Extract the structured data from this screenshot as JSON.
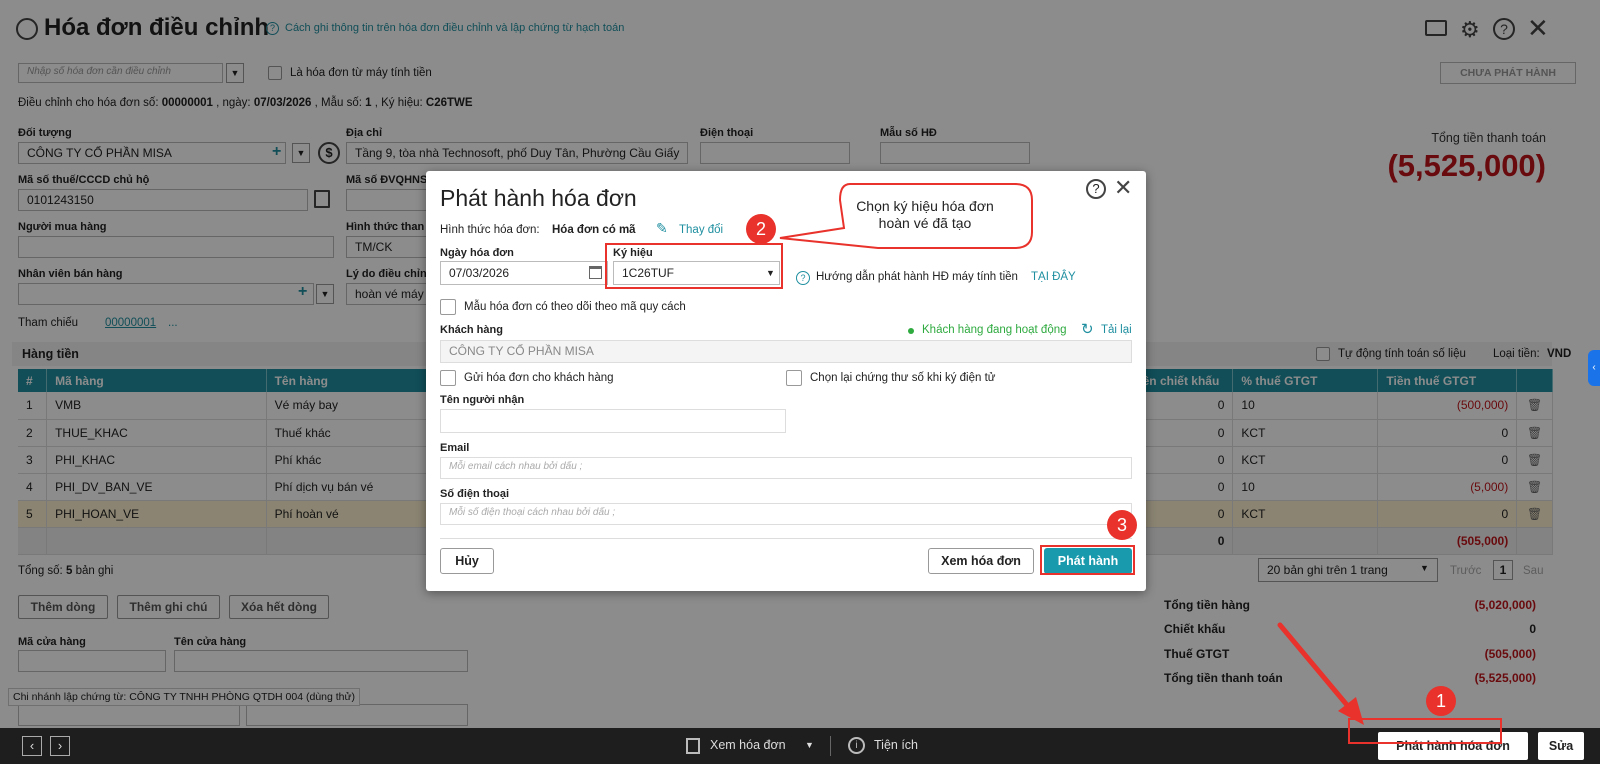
{
  "header": {
    "title": "Hóa đơn điều chỉnh",
    "help_link": "Cách ghi thông tin trên hóa đơn điều chỉnh và lập chứng từ hạch toán"
  },
  "topbar": {
    "search_placeholder": "Nhập số hóa đơn cần điều chỉnh",
    "cash_register_label": "Là hóa đơn từ máy tính tiền",
    "status_button": "CHƯA PHÁT HÀNH",
    "adjust_prefix": "Điều chỉnh cho hóa đơn số:",
    "adjust_number": "00000001",
    "adjust_date_label": ", ngày:",
    "adjust_date": "07/03/2026",
    "adjust_form_label": ", Mẫu số:",
    "adjust_form": "1",
    "adjust_symbol_label": ", Ký hiệu:",
    "adjust_symbol": "C26TWE"
  },
  "form": {
    "doi_tuong_label": "Đối tượng",
    "doi_tuong_value": "CÔNG TY CỔ PHẦN MISA",
    "dia_chi_label": "Địa chỉ",
    "dia_chi_value": "Tầng 9, tòa nhà Technosoft, phố Duy Tân, Phường Cầu Giấy",
    "dien_thoai_label": "Điện thoại",
    "mau_so_hd_label": "Mẫu số HĐ",
    "mst_label": "Mã số thuế/CCCD chủ hộ",
    "mst_value": "0101243150",
    "ma_dvqhns_label": "Mã số ĐVQHNS",
    "nguoi_mua_label": "Người mua hàng",
    "hinh_thuc_label": "Hình thức than",
    "hinh_thuc_value": "TM/CK",
    "nhan_vien_label": "Nhân viên bán hàng",
    "ly_do_label": "Lý do điều chỉnh",
    "ly_do_value": "hoàn vé máy",
    "tham_chieu_label": "Tham chiếu",
    "tham_chieu_value": "00000001",
    "tham_chieu_more": "...",
    "total_label": "Tổng tiền thanh toán",
    "total_value": "(5,525,000)"
  },
  "items": {
    "section_title": "Hàng tiền",
    "auto_calc_label": "Tự động tính toán số liệu",
    "currency_label": "Loại tiền:",
    "currency_value": "VND",
    "columns": [
      "#",
      "Mã hàng",
      "Tên hàng",
      "Tiền chiết khấu",
      "% thuế GTGT",
      "Tiền thuế GTGT"
    ],
    "rows": [
      {
        "no": "1",
        "code": "VMB",
        "name": "Vé máy bay",
        "discount": "0",
        "vat_rate": "10",
        "vat": "(500,000)"
      },
      {
        "no": "2",
        "code": "THUE_KHAC",
        "name": "Thuế khác",
        "discount": "0",
        "vat_rate": "KCT",
        "vat": "0"
      },
      {
        "no": "3",
        "code": "PHI_KHAC",
        "name": "Phí khác",
        "discount": "0",
        "vat_rate": "KCT",
        "vat": "0"
      },
      {
        "no": "4",
        "code": "PHI_DV_BAN_VE",
        "name": "Phí dịch vụ bán vé",
        "discount": "0",
        "vat_rate": "10",
        "vat": "(5,000)"
      },
      {
        "no": "5",
        "code": "PHI_HOAN_VE",
        "name": "Phí hoàn vé",
        "discount": "0",
        "vat_rate": "KCT",
        "vat": "0"
      }
    ],
    "sum_discount": "0",
    "sum_vat": "(505,000)",
    "record_count_label": "Tổng số:",
    "record_count": "5",
    "record_count_suffix": "bản ghi",
    "page_size": "20 bản ghi trên 1 trang",
    "prev": "Trước",
    "page": "1",
    "next": "Sau",
    "add_row": "Thêm dòng",
    "add_note": "Thêm ghi chú",
    "delete_all": "Xóa hết dòng"
  },
  "store": {
    "code_label": "Mã cửa hàng",
    "name_label": "Tên cửa hàng",
    "branch_note": "Chi nhánh lập chứng từ: CÔNG TY TNHH PHÒNG QTDH 004 (dùng thử)"
  },
  "summary": {
    "tong_tien_hang_label": "Tổng tiền hàng",
    "tong_tien_hang": "(5,020,000)",
    "chiet_khau_label": "Chiết khấu",
    "chiet_khau": "0",
    "thue_label": "Thuế GTGT",
    "thue": "(505,000)",
    "thanh_toan_label": "Tổng tiền thanh toán",
    "thanh_toan": "(5,525,000)"
  },
  "bottombar": {
    "preview": "Xem hóa đơn",
    "utilities": "Tiện ích",
    "issue": "Phát hành hóa đơn",
    "edit": "Sửa"
  },
  "modal": {
    "title": "Phát hành hóa đơn",
    "form_type_label": "Hình thức hóa đơn:",
    "form_type_value": "Hóa đơn có mã",
    "change_link": "Thay đổi",
    "date_label": "Ngày hóa đơn",
    "date_value": "07/03/2026",
    "symbol_label": "Ký hiệu",
    "symbol_value": "1C26TUF",
    "guide_text": "Hướng dẫn phát hành HĐ máy tính tiền",
    "guide_link": "TẠI ĐÂY",
    "tracking_label": "Mẫu hóa đơn có theo dõi theo mã quy cách",
    "customer_label": "Khách hàng",
    "customer_status": "Khách hàng đang hoạt động",
    "reload": "Tải lại",
    "customer_value": "CÔNG TY CỔ PHẦN MISA",
    "send_label": "Gửi hóa đơn cho khách hàng",
    "reselect_cert_label": "Chọn lại chứng thư số khi ký điện tử",
    "receiver_label": "Tên người nhận",
    "email_label": "Email",
    "email_placeholder": "Mỗi email cách nhau bởi dấu ;",
    "phone_label": "Số điện thoại",
    "phone_placeholder": "Mỗi số điện thoại cách nhau bởi dấu ;",
    "cancel": "Hủy",
    "preview": "Xem hóa đơn",
    "issue": "Phát hành"
  },
  "annotations": {
    "callout_text": "Chọn ký hiệu hóa đơn hoàn vé đã tạo",
    "step1": "1",
    "step2": "2",
    "step3": "3"
  },
  "colors": {
    "accent": "#1f8fa0",
    "danger": "#c0141b",
    "annotation_red": "#e8322b",
    "status_green": "#2eaa3f"
  }
}
